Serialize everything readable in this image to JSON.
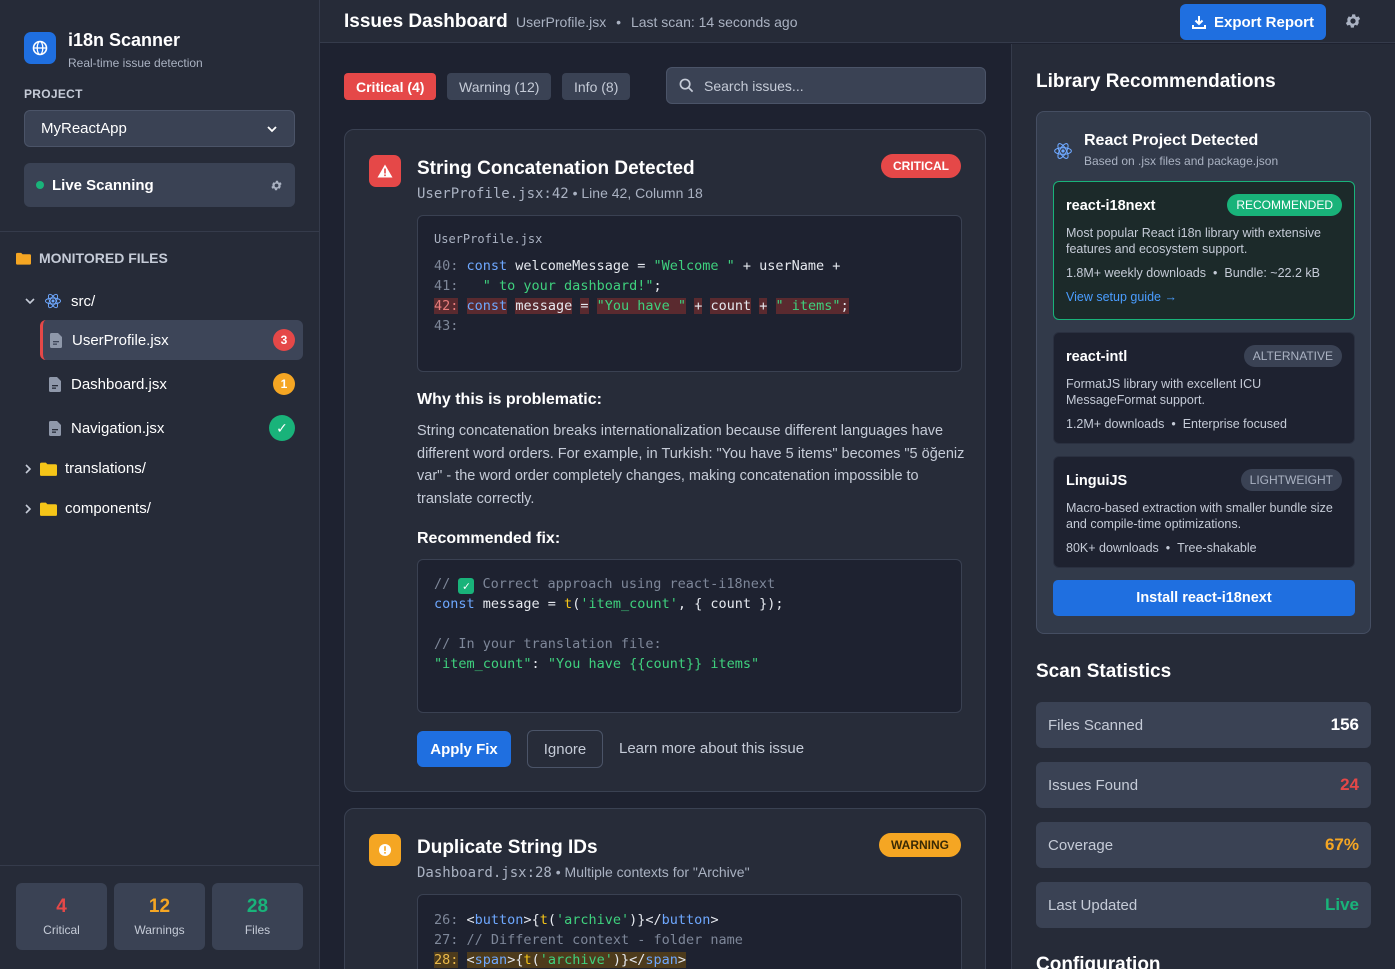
{
  "sidebar": {
    "brand_title": "i18n Scanner",
    "brand_subtitle": "Real-time issue detection",
    "project_label": "PROJECT",
    "project_selected": "MyReactApp",
    "live_label": "Live Scanning",
    "monitored_label": "MONITORED FILES",
    "tree": {
      "src": "src/",
      "files": [
        {
          "name": "UserProfile.jsx",
          "badge": "3",
          "badge_color": "#e54848"
        },
        {
          "name": "Dashboard.jsx",
          "badge": "1",
          "badge_color": "#f5a623"
        },
        {
          "name": "Navigation.jsx",
          "badge": "✓",
          "badge_color": "#19b37a"
        }
      ],
      "translations": "translations/",
      "components": "components/"
    },
    "stats": [
      {
        "value": "4",
        "label": "Critical",
        "color": "#e54848"
      },
      {
        "value": "12",
        "label": "Warnings",
        "color": "#f5a623"
      },
      {
        "value": "28",
        "label": "Files",
        "color": "#19b37a"
      }
    ]
  },
  "header": {
    "title": "Issues Dashboard",
    "file": "UserProfile.jsx",
    "separator": "•",
    "last_scan": "Last scan: 14 seconds ago",
    "export_label": "Export Report"
  },
  "main": {
    "tabs": [
      {
        "label": "Critical (4)"
      },
      {
        "label": "Warning (12)"
      },
      {
        "label": "Info (8)"
      }
    ],
    "search_placeholder": "Search issues...",
    "issue1": {
      "title": "String Concatenation Detected",
      "file_ref": "UserProfile.jsx:42",
      "location": " • Line 42, Column 18",
      "severity": "CRITICAL",
      "code_filename": "UserProfile.jsx",
      "why_heading": "Why this is problematic:",
      "why_text": "String concatenation breaks internationalization because different languages have different word orders. For example, in Turkish: \"You have 5 items\" becomes \"5 öğeniz var\" - the word order completely changes, making concatenation impossible to translate correctly.",
      "fix_heading": "Recommended fix:",
      "apply_label": "Apply Fix",
      "ignore_label": "Ignore",
      "learn_label": "Learn more about this issue"
    },
    "issue2": {
      "title": "Duplicate String IDs",
      "file_ref": "Dashboard.jsx:28",
      "location": " • Multiple contexts for \"Archive\"",
      "severity": "WARNING"
    }
  },
  "right": {
    "lib_title": "Library Recommendations",
    "detected_title": "React Project Detected",
    "detected_sub": "Based on .jsx files and package.json",
    "libs": [
      {
        "name": "react-i18next",
        "tag": "RECOMMENDED",
        "desc": "Most popular React i18n library with extensive features and ecosystem support.",
        "downloads": "1.8M+ weekly downloads",
        "extra": "Bundle: ~22.2 kB",
        "link": "View setup guide →"
      },
      {
        "name": "react-intl",
        "tag": "ALTERNATIVE",
        "desc": "FormatJS library with excellent ICU MessageFormat support.",
        "downloads": "1.2M+ downloads",
        "extra": "Enterprise focused"
      },
      {
        "name": "LinguiJS",
        "tag": "LIGHTWEIGHT",
        "desc": "Macro-based extraction with smaller bundle size and compile-time optimizations.",
        "downloads": "80K+ downloads",
        "extra": "Tree-shakable"
      }
    ],
    "install_label": "Install react-i18next",
    "stats_title": "Scan Statistics",
    "stats": [
      {
        "label": "Files Scanned",
        "value": "156",
        "color": "#ffffff"
      },
      {
        "label": "Issues Found",
        "value": "24",
        "color": "#e54848"
      },
      {
        "label": "Coverage",
        "value": "67%",
        "color": "#f5a623"
      },
      {
        "label": "Last Updated",
        "value": "Live",
        "color": "#19b37a"
      }
    ],
    "config_title": "Configuration"
  }
}
